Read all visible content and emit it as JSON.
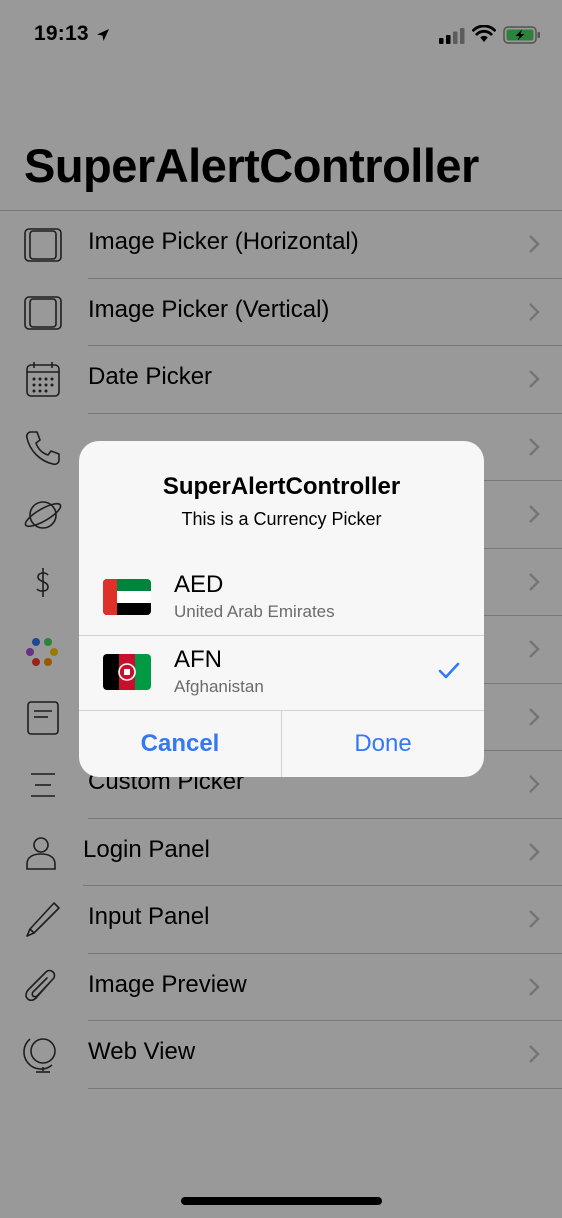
{
  "status_bar": {
    "time": "19:13"
  },
  "nav": {
    "title": "SuperAlertController"
  },
  "menu": {
    "items": [
      {
        "label": "Image Picker (Horizontal)",
        "icon": "tablet-landscape-icon"
      },
      {
        "label": "Image Picker (Vertical)",
        "icon": "tablet-portrait-icon"
      },
      {
        "label": "Date Picker",
        "icon": "calendar-icon"
      },
      {
        "label": "",
        "icon": "phone-icon"
      },
      {
        "label": "",
        "icon": "planet-icon"
      },
      {
        "label": "",
        "icon": "dollar-icon"
      },
      {
        "label": "",
        "icon": "color-dots-icon"
      },
      {
        "label": "",
        "icon": "document-icon"
      },
      {
        "label": "Custom Picker",
        "icon": "lines-icon"
      },
      {
        "label": "Login Panel",
        "icon": "user-icon"
      },
      {
        "label": "Input Panel",
        "icon": "pencil-icon"
      },
      {
        "label": "Image Preview",
        "icon": "paperclip-icon"
      },
      {
        "label": "Web View",
        "icon": "globe-icon"
      }
    ]
  },
  "alert": {
    "title": "SuperAlertController",
    "message": "This is a Currency Picker",
    "currencies": [
      {
        "code": "AED",
        "country": "United Arab Emirates",
        "selected": false,
        "flag": "uae-flag-icon"
      },
      {
        "code": "AFN",
        "country": "Afghanistan",
        "selected": true,
        "flag": "afghanistan-flag-icon"
      }
    ],
    "cancel_label": "Cancel",
    "done_label": "Done"
  },
  "colors": {
    "accent": "#3478f6",
    "separator": "#c8c7cc",
    "dim_overlay": "rgba(0,0,0,0.4)"
  }
}
